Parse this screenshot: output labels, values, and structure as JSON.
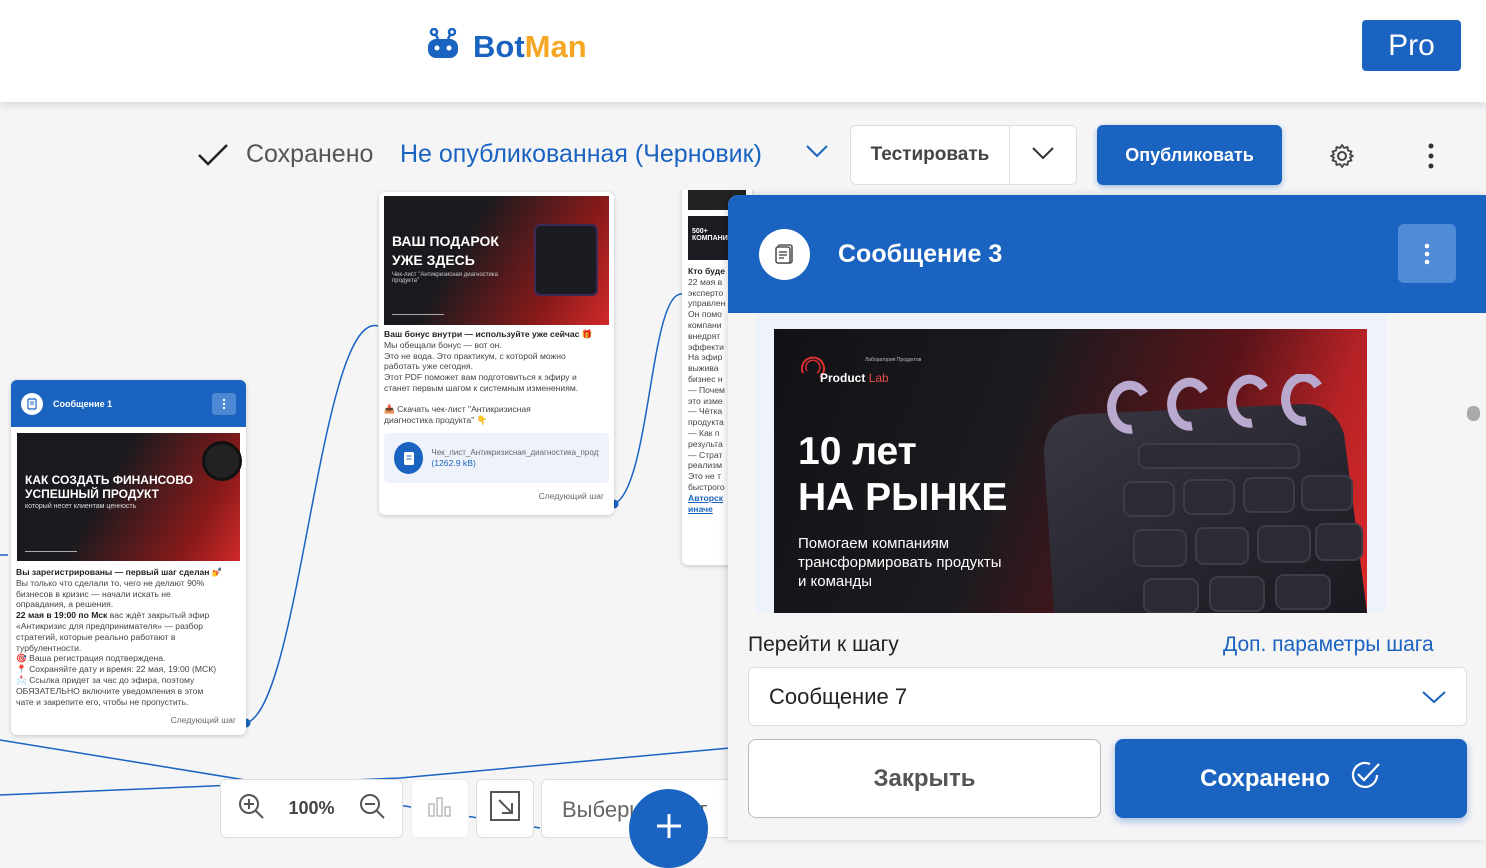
{
  "app": {
    "logo_part1": "Bot",
    "logo_part2": "Man",
    "pro_label": "Pro"
  },
  "toolbar": {
    "saved_label": "Сохранено",
    "status_label": "Не опубликованная (Черновик)",
    "test_label": "Тестировать",
    "publish_label": "Опубликовать"
  },
  "nodes": {
    "n1": {
      "title": "Сообщение 1",
      "banner_title": "КАК СОЗДАТЬ ФИНАНСОВО УСПЕШНЫЙ ПРОДУКТ",
      "banner_sub": "который несет клиентам ценность",
      "lead": "Вы зарегистрированы — первый шаг сделан 💅",
      "lines": [
        "Вы только что сделали то, чего не делают 90%",
        "бизнесов в кризис — начали искать не",
        "оправдания, а решения."
      ],
      "bold_line": "22 мая в 19:00 по Мск",
      "bold_line_rest": " вас ждёт закрытый эфир",
      "lines2": [
        "«Антикризис для предпринимателя» — разбор",
        "стратегий, которые реально работают в",
        "турбулентности.",
        "🎯 Ваша регистрация подтверждена.",
        "📍 Сохраняйте дату и время: 22 мая, 19:00 (МСК)",
        "📩 Ссылка придет за час до эфира, поэтому",
        "ОБЯЗАТЕЛЬНО включите уведомления в этом",
        "чате и закрепите его, чтобы не пропустить."
      ],
      "next_step": "Следующий шаг"
    },
    "n2": {
      "banner_title": "ВАШ ПОДАРОК УЖЕ ЗДЕСЬ",
      "banner_sub": "Чек-лист \"Антикризисная диагностика продукта\"",
      "lead": "Ваш бонус внутри — используйте уже сейчас 🎁",
      "lines": [
        "Мы обещали бонус — вот он.",
        "Это не вода. Это практикум, с которой можно",
        "работать уже сегодня.",
        "Этот PDF поможет вам подготовиться к эфиру и",
        "станет первым шагом к системным изменениям."
      ],
      "checklist": "📥 Скачать чек-лист \"Антикризисная диагностика продукта\" 👇",
      "file_name": "Чек_лист_Антикризисная_диагностика_продукта",
      "file_size": "(1262.9 kB)",
      "next_step": "Следующий шаг"
    },
    "n3": {
      "badge": "500+ КОМПАНИ",
      "lines": [
        "Кто буде",
        "22 мая в",
        "эксперто",
        "управлен",
        "Он помо",
        "компани",
        "внедрят",
        "эффекти",
        "На эфир",
        "выжива",
        "бизнес н",
        "— Почем",
        "это изме",
        "— Чётка",
        "продукта",
        "— Как п",
        "результа",
        "— Страт",
        "реализм",
        "Это не т",
        "быстрого",
        "Авторск",
        "иначе"
      ]
    }
  },
  "panel": {
    "title": "Сообщение 3",
    "banner_logo": "Product",
    "banner_logo_accent": "Lab",
    "banner_small": "Лаборатория Продуктов",
    "banner_h1_line1": "10 лет",
    "banner_h1_line2": "НА РЫНКЕ",
    "banner_sub_line1": "Помогаем компаниям",
    "banner_sub_line2": "трансформировать продукты",
    "banner_sub_line3": "и команды",
    "goto_label": "Перейти к шагу",
    "params_link": "Доп. параметры шага",
    "select_value": "Сообщение 7",
    "close_label": "Закрыть",
    "save_label": "Сохранено"
  },
  "bottom": {
    "zoom": "100%",
    "step_placeholder": "Выберите шаг"
  }
}
